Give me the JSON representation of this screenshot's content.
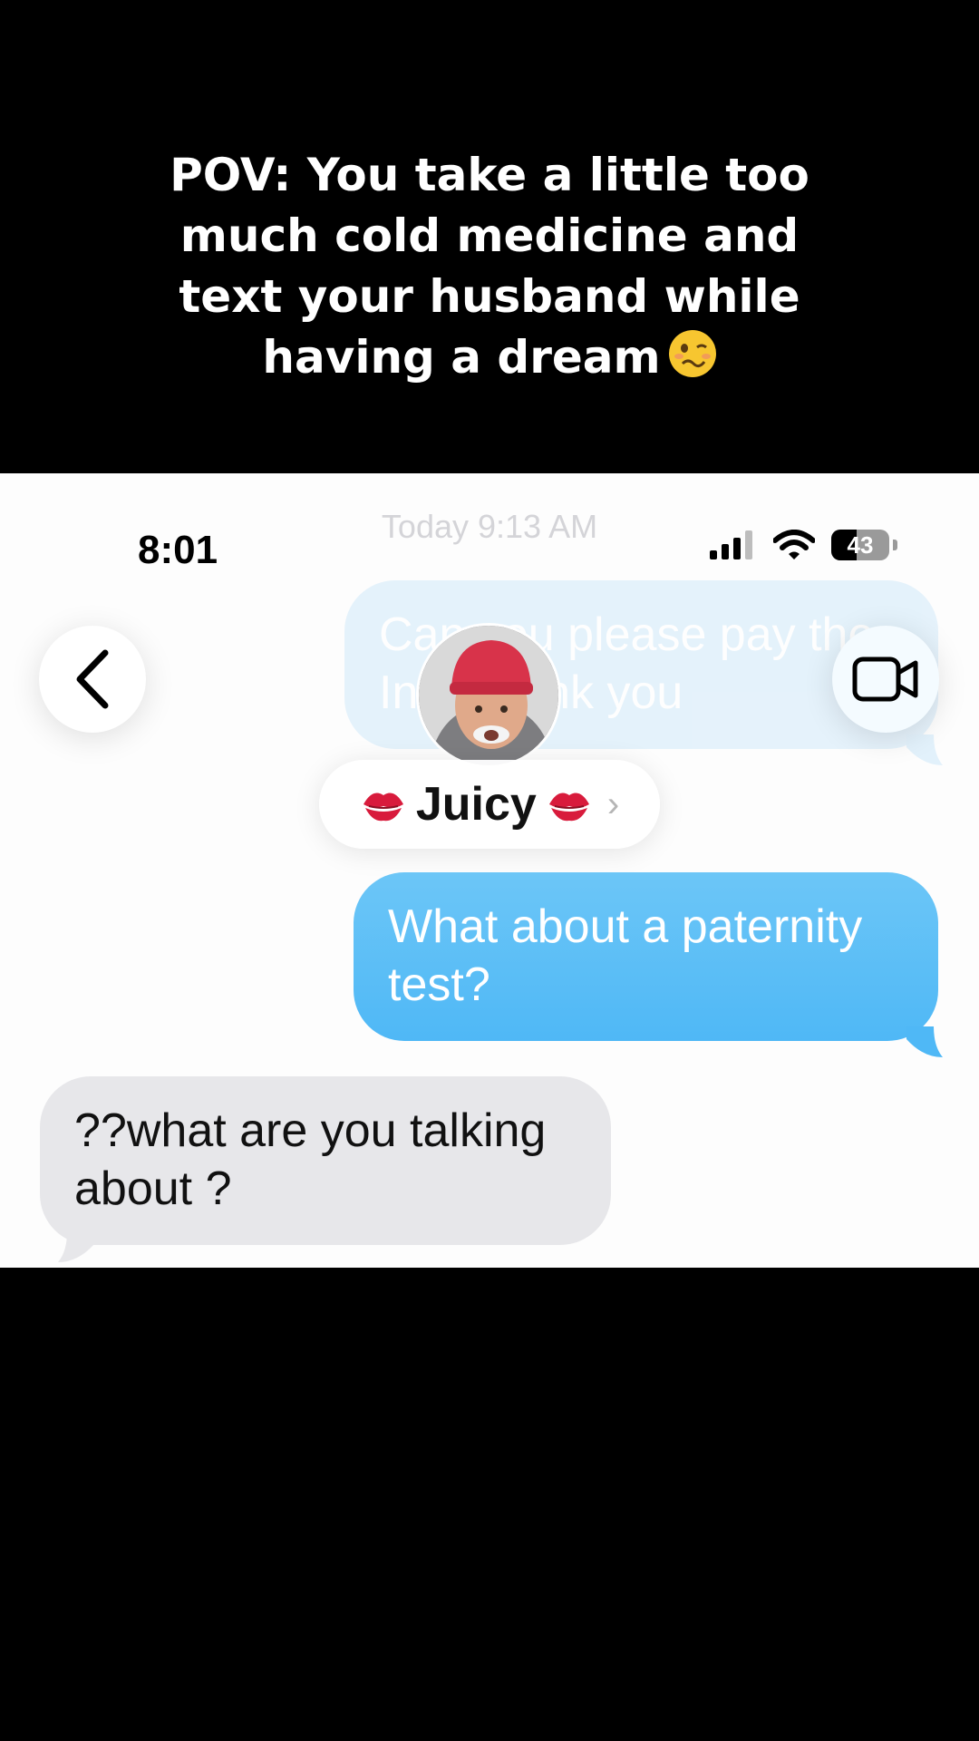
{
  "caption": {
    "lines": [
      "POV: You take a little too",
      "much cold medicine and",
      "text your husband while",
      "having a dream"
    ],
    "emoji_icon": "woozy-face-icon"
  },
  "status_bar": {
    "time": "8:01",
    "battery_level": "43",
    "battery_fraction": 0.43,
    "icons": [
      "cellular-signal-icon",
      "wifi-icon",
      "battery-icon"
    ]
  },
  "thread": {
    "date_label": "Today 9:13 AM",
    "faded_message_lines": [
      "Can you please pay the",
      "In… thank you"
    ],
    "messages": [
      {
        "direction": "sent",
        "text_lines": [
          "What about a paternity",
          "test?"
        ],
        "color": "#4fb8f6"
      },
      {
        "direction": "received",
        "text_lines": [
          "??what are you talking",
          "about ?"
        ],
        "color": "#e7e7ea"
      }
    ]
  },
  "header": {
    "contact_name": "Juicy",
    "name_emoji_icon": "kiss-mark-icon",
    "back_icon": "chevron-left-icon",
    "video_icon": "video-camera-icon",
    "pill_chevron": "›"
  }
}
